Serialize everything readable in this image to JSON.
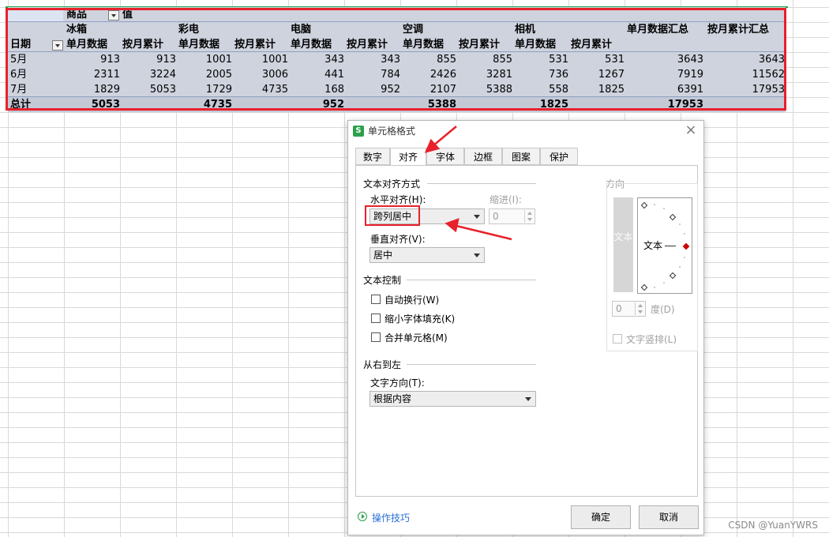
{
  "pivot": {
    "corner_label": "商品",
    "value_label": "值",
    "row_field_label": "日期",
    "products": [
      "冰箱",
      "彩电",
      "电脑",
      "空调",
      "相机"
    ],
    "summary_headers": [
      "单月数据汇总",
      "按月累计汇总"
    ],
    "sub_headers": [
      "单月数据",
      "按月累计",
      "单月数据",
      "按月累计",
      "单月数据",
      "按月累计",
      "单月数据",
      "按月累计",
      "单月数据",
      "按月累计"
    ],
    "rows": [
      {
        "label": "5月",
        "values": [
          "913",
          "913",
          "1001",
          "1001",
          "343",
          "343",
          "855",
          "855",
          "531",
          "531",
          "3643",
          "3643"
        ]
      },
      {
        "label": "6月",
        "values": [
          "2311",
          "3224",
          "2005",
          "3006",
          "441",
          "784",
          "2426",
          "3281",
          "736",
          "1267",
          "7919",
          "11562"
        ]
      },
      {
        "label": "7月",
        "values": [
          "1829",
          "5053",
          "1729",
          "4735",
          "168",
          "952",
          "2107",
          "5388",
          "558",
          "1825",
          "6391",
          "17953"
        ]
      }
    ],
    "total": {
      "label": "总计",
      "values": [
        "5053",
        "",
        "4735",
        "",
        "952",
        "",
        "5388",
        "",
        "1825",
        "",
        "17953",
        ""
      ]
    }
  },
  "dialog": {
    "title": "单元格格式",
    "tabs": [
      "数字",
      "对齐",
      "字体",
      "边框",
      "图案",
      "保护"
    ],
    "active_tab": "对齐",
    "text_align_group": "文本对齐方式",
    "horizontal_label": "水平对齐(H):",
    "horizontal_value": "跨列居中",
    "indent_label": "缩进(I):",
    "indent_value": "0",
    "vertical_label": "垂直对齐(V):",
    "vertical_value": "居中",
    "text_control_group": "文本控制",
    "wrap_label": "自动换行(W)",
    "shrink_label": "缩小字体填充(K)",
    "merge_label": "合并单元格(M)",
    "rtl_group": "从右到左",
    "text_direction_label": "文字方向(T):",
    "text_direction_value": "根据内容",
    "orientation_group": "方向",
    "vertical_text_sample": "文本",
    "dial_text": "文本",
    "degree_value": "0",
    "degree_label": "度(D)",
    "vertical_stack_label": "文字竖排(L)",
    "ok_label": "确定",
    "cancel_label": "取消",
    "tips_label": "操作技巧"
  },
  "watermark": "CSDN @YuanYWRS",
  "colors": {
    "highlight": "#e8212b",
    "pivot_bg": "#cfd3de",
    "link": "#2a6fdb",
    "app_icon": "#2aa14a"
  }
}
